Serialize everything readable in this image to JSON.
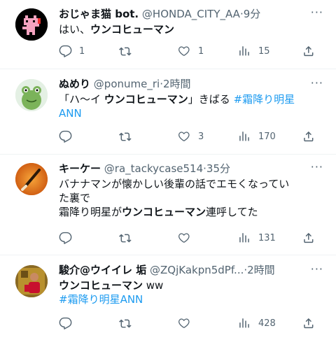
{
  "tweets": [
    {
      "name": "おじゃま猫 bot.",
      "handle": "@HONDA_CITY_AA",
      "dot": "·",
      "time": "9分",
      "lines": [
        [
          {
            "t": "はい、"
          },
          {
            "t": "ウンコヒューマン",
            "b": true
          }
        ]
      ],
      "replies": "1",
      "retweets": "",
      "likes": "1",
      "views": "15"
    },
    {
      "name": "ぬめり",
      "handle": "@ponume_ri",
      "dot": "·",
      "time": "2時間",
      "lines": [
        [
          {
            "t": "「ハ〜イ "
          },
          {
            "t": "ウンコヒューマン",
            "b": true
          },
          {
            "t": "」きばる "
          },
          {
            "t": "#霜降り明星",
            "tag": true
          }
        ],
        [
          {
            "t": "ANN",
            "tag": true
          }
        ]
      ],
      "replies": "",
      "retweets": "",
      "likes": "3",
      "views": "170"
    },
    {
      "name": "キーケー",
      "handle": "@ra_tackycase514",
      "dot": "·",
      "time": "35分",
      "lines": [
        [
          {
            "t": "バナナマンが懐かしい後輩の話でエモくなってい"
          }
        ],
        [
          {
            "t": "た裏で"
          }
        ],
        [
          {
            "t": "霜降り明星が"
          },
          {
            "t": "ウンコヒューマン",
            "b": true
          },
          {
            "t": "連呼してた"
          }
        ]
      ],
      "replies": "",
      "retweets": "",
      "likes": "",
      "views": "131"
    },
    {
      "name": "駿介@ウイイレ 垢",
      "handle": "@ZQjKakpn5dPf...",
      "dot": "·",
      "time": "2時間",
      "lines": [
        [
          {
            "t": "ウンコヒューマン",
            "b": true
          },
          {
            "t": " ww"
          }
        ],
        [
          {
            "t": "#霜降り明星ANN",
            "tag": true
          }
        ]
      ],
      "replies": "",
      "retweets": "",
      "likes": "",
      "views": "428"
    }
  ],
  "more_label": "···",
  "colors": {
    "text": "#0f1419",
    "secondary": "#536471",
    "link": "#1d9bf0",
    "divider": "#eff3f4"
  }
}
